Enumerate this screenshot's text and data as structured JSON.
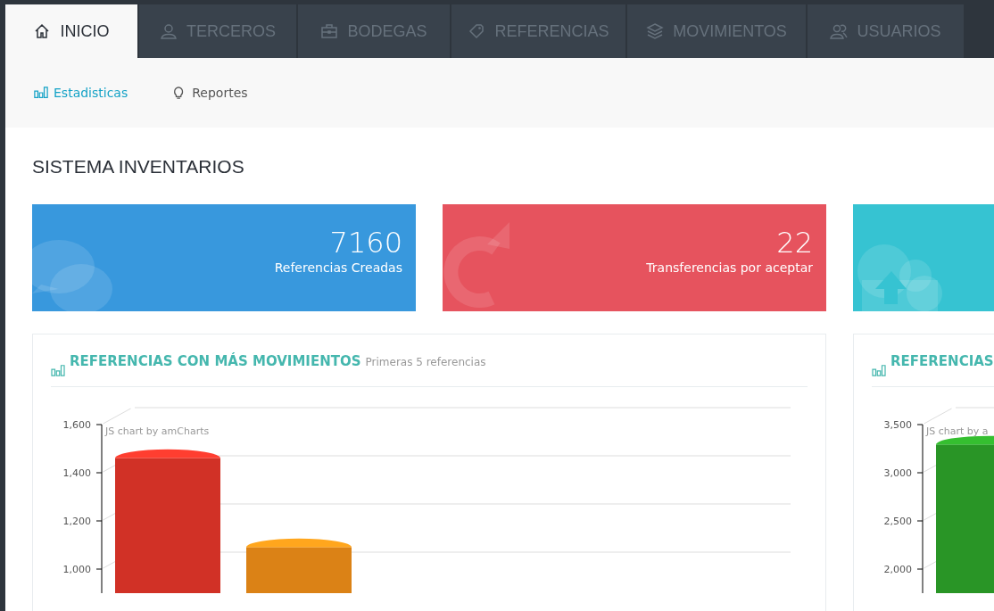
{
  "tabs": [
    {
      "label": "INICIO",
      "selected": true
    },
    {
      "label": "TERCEROS",
      "selected": false
    },
    {
      "label": "BODEGAS",
      "selected": false
    },
    {
      "label": "REFERENCIAS",
      "selected": false
    },
    {
      "label": "MOVIMIENTOS",
      "selected": false
    },
    {
      "label": "USUARIOS",
      "selected": false
    }
  ],
  "subnav": [
    {
      "label": "Estadisticas",
      "selected": true
    },
    {
      "label": "Reportes",
      "selected": false
    }
  ],
  "page_title": "SISTEMA INVENTARIOS",
  "stat_cards": [
    {
      "value": "7160",
      "label": "Referencias Creadas",
      "color": "#3898dd"
    },
    {
      "value": "22",
      "label": "Transferencias por aceptar",
      "color": "#e6535e"
    },
    {
      "color": "#36c3d2"
    }
  ],
  "panels": [
    {
      "title": "REFERENCIAS CON MÁS MOVIMIENTOS",
      "subtitle": "Primeras 5 referencias",
      "credit": "JS chart by amCharts",
      "chart_data": {
        "type": "bar",
        "ylim": [
          900,
          1600
        ],
        "values": [
          1460,
          1090
        ],
        "colors": [
          "#e8362a",
          "#f39019"
        ],
        "yticks": [
          {
            "value": 1000,
            "label": "1,000"
          },
          {
            "value": 1200,
            "label": "1,200"
          },
          {
            "value": 1400,
            "label": "1,400"
          },
          {
            "value": 1600,
            "label": "1,600"
          }
        ]
      }
    },
    {
      "title": "REFERENCIAS",
      "credit": "JS chart by a",
      "chart_data": {
        "type": "bar",
        "ylim": [
          1750,
          3500
        ],
        "values": [
          3290
        ],
        "colors": [
          "#2ea62a"
        ],
        "yticks": [
          {
            "value": 2000,
            "label": "2,000"
          },
          {
            "value": 2500,
            "label": "2,500"
          },
          {
            "value": 3000,
            "label": "3,000"
          },
          {
            "value": 3500,
            "label": "3,500"
          }
        ]
      }
    }
  ]
}
